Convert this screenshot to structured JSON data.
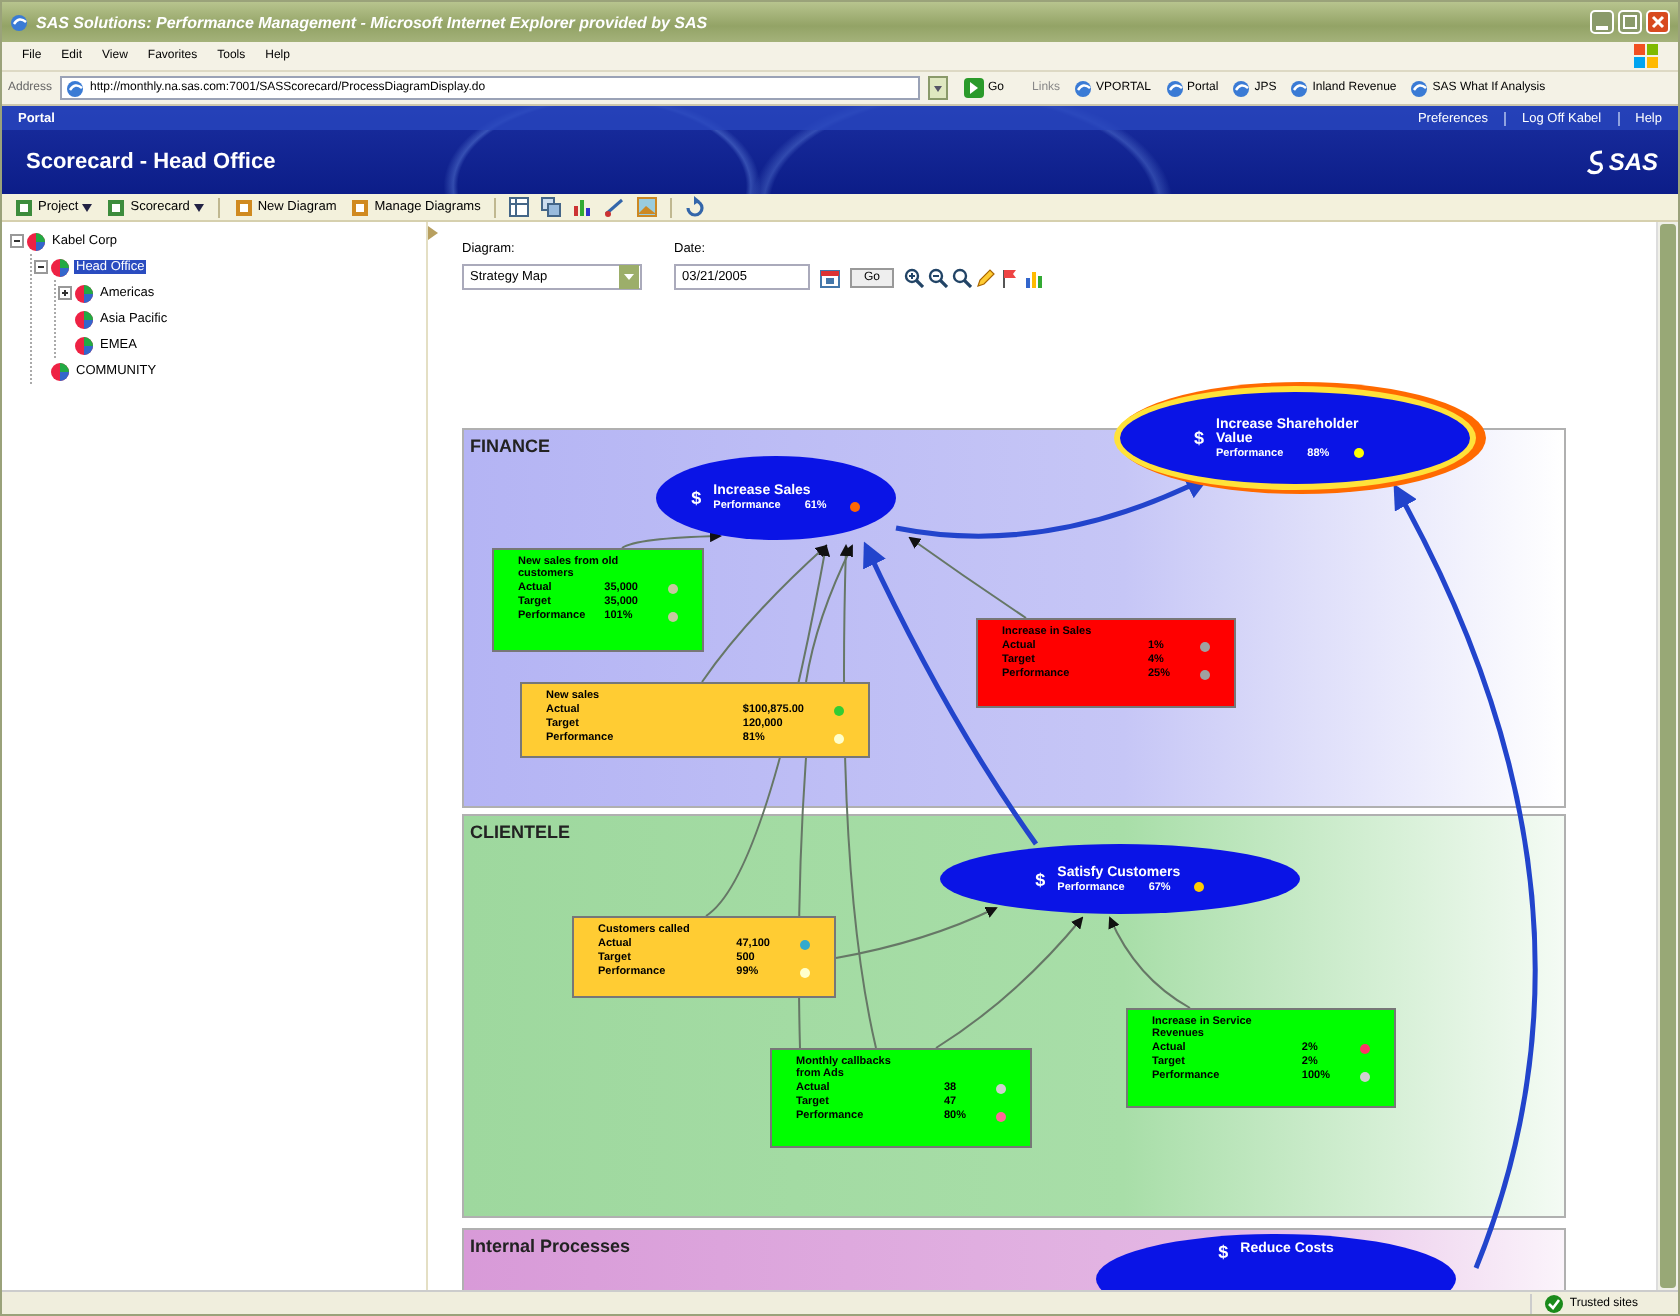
{
  "window": {
    "title": "SAS Solutions: Performance Management - Microsoft Internet Explorer provided by SAS"
  },
  "menu": [
    "File",
    "Edit",
    "View",
    "Favorites",
    "Tools",
    "Help"
  ],
  "address_bar": {
    "label": "Address",
    "url": "http://monthly.na.sas.com:7001/SASScorecard/ProcessDiagramDisplay.do",
    "go": "Go"
  },
  "links": {
    "label": "Links",
    "items": [
      "VPORTAL",
      "Portal",
      "JPS",
      "Inland Revenue",
      "SAS What If Analysis"
    ]
  },
  "portal": {
    "breadcrumb": "Portal",
    "title": "Scorecard - Head Office",
    "links": [
      "Preferences",
      "Log Off Kabel",
      "Help"
    ],
    "logo": "SAS"
  },
  "toolbar": [
    {
      "label": "Project",
      "kind": "menu"
    },
    {
      "label": "Scorecard",
      "kind": "menu"
    },
    {
      "label": "New Diagram",
      "kind": "button"
    },
    {
      "label": "Manage Diagrams",
      "kind": "button"
    }
  ],
  "tree": [
    {
      "label": "Kabel Corp",
      "selected": false,
      "expanded": true,
      "children": [
        {
          "label": "Head Office",
          "selected": true,
          "expanded": true,
          "children": [
            {
              "label": "Americas",
              "selected": false,
              "expanded": false
            },
            {
              "label": "Asia Pacific",
              "selected": false
            },
            {
              "label": "EMEA",
              "selected": false
            }
          ]
        },
        {
          "label": "COMMUNITY",
          "selected": false
        }
      ]
    }
  ],
  "diagram_selector": {
    "label": "Diagram:",
    "value": "Strategy Map"
  },
  "date": {
    "label": "Date:",
    "value": "03/21/2005"
  },
  "go_button": "Go",
  "perspectives": [
    {
      "name": "FINANCE",
      "kind": "finance"
    },
    {
      "name": "CLIENTELE",
      "kind": "customer"
    },
    {
      "name": "Internal Processes",
      "kind": "process"
    }
  ],
  "objectives": [
    {
      "title": "Increase Sales",
      "symbol": "$",
      "label": "Performance",
      "value": "61%",
      "color": "#ff6600",
      "highlight": false
    },
    {
      "title": "Increase Shareholder Value",
      "symbol": "$",
      "label": "Performance",
      "value": "88%",
      "color": "#ffff00",
      "highlight": true
    },
    {
      "title": "Satisfy Customers",
      "symbol": "$",
      "label": "Performance",
      "value": "67%",
      "color": "#ffcc00",
      "highlight": false
    },
    {
      "title": "Reduce Costs",
      "symbol": "$",
      "highlight": false
    }
  ],
  "kpis": [
    {
      "title": "New sales from old customers",
      "color": "#00ff00",
      "rows": [
        {
          "label": "Actual",
          "value": "35,000",
          "color": "#c8c8a0"
        },
        {
          "label": "Target",
          "value": "35,000"
        },
        {
          "label": "Performance",
          "value": "101%",
          "color": "#c8c8a0"
        }
      ]
    },
    {
      "title": "New sales",
      "color": "#ffcc33",
      "rows": [
        {
          "label": "Actual",
          "value": "$100,875.00",
          "color": "#33cc33"
        },
        {
          "label": "Target",
          "value": "120,000"
        },
        {
          "label": "Performance",
          "value": "81%",
          "color": "#ffffcc"
        }
      ]
    },
    {
      "title": "Increase in Sales",
      "color": "#ff0000",
      "rows": [
        {
          "label": "Actual",
          "value": "1%",
          "color": "#a0a0a0"
        },
        {
          "label": "Target",
          "value": "4%"
        },
        {
          "label": "Performance",
          "value": "25%",
          "color": "#a0a0a0"
        }
      ]
    },
    {
      "title": "Customers called",
      "color": "#ffcc33",
      "rows": [
        {
          "label": "Actual",
          "value": "47,100",
          "color": "#33aacc"
        },
        {
          "label": "Target",
          "value": "500"
        },
        {
          "label": "Performance",
          "value": "99%",
          "color": "#ffffcc"
        }
      ]
    },
    {
      "title": "Monthly callbacks from Ads",
      "color": "#00ff00",
      "rows": [
        {
          "label": "Actual",
          "value": "38",
          "color": "#d0d0d0"
        },
        {
          "label": "Target",
          "value": "47"
        },
        {
          "label": "Performance",
          "value": "80%",
          "color": "#ff6699"
        }
      ]
    },
    {
      "title": "Increase in Service Revenues",
      "color": "#00ff00",
      "rows": [
        {
          "label": "Actual",
          "value": "2%",
          "color": "#ff3366"
        },
        {
          "label": "Target",
          "value": "2%"
        },
        {
          "label": "Performance",
          "value": "100%",
          "color": "#d0d0d0"
        }
      ]
    }
  ],
  "status_bar": {
    "zone": "Trusted sites"
  }
}
